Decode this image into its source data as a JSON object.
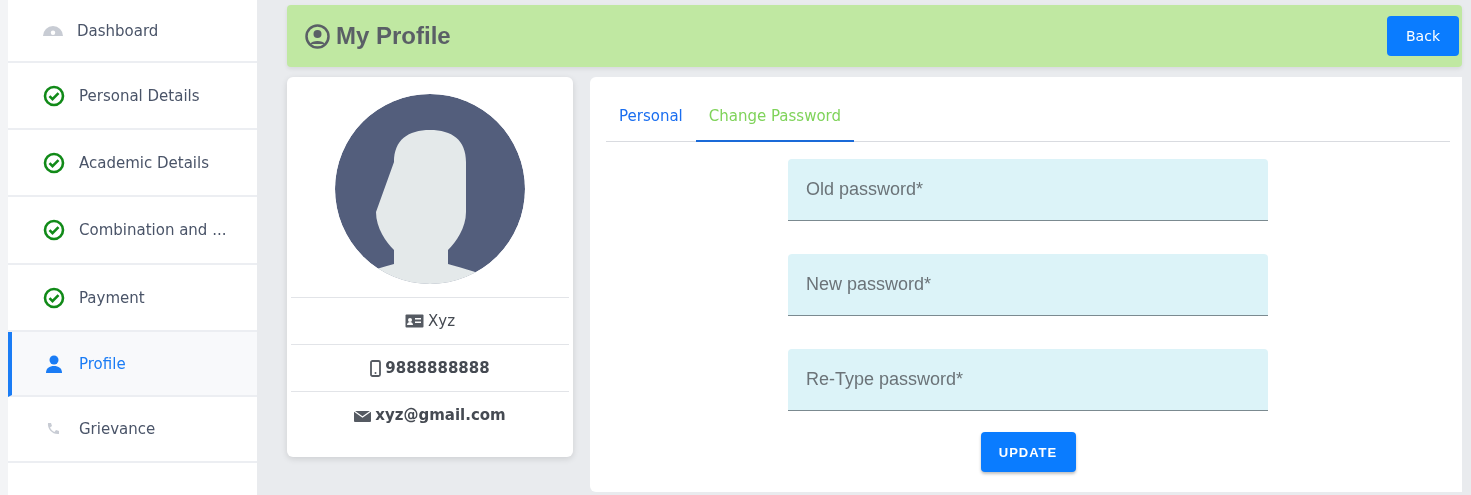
{
  "sidebar": {
    "items": [
      {
        "label": "Dashboard",
        "kind": "dashboard",
        "selected": false
      },
      {
        "label": "Personal Details",
        "kind": "done",
        "selected": false
      },
      {
        "label": "Academic Details",
        "kind": "done",
        "selected": false
      },
      {
        "label": "Combination and ...",
        "kind": "done",
        "selected": false
      },
      {
        "label": "Payment",
        "kind": "done",
        "selected": false
      },
      {
        "label": "Profile",
        "kind": "profile",
        "selected": true
      },
      {
        "label": "Grievance",
        "kind": "phone",
        "selected": false
      }
    ]
  },
  "header": {
    "title": "My Profile",
    "back_button": "Back"
  },
  "profile_card": {
    "avatar": {
      "kind": "silhouette"
    },
    "details": [
      {
        "kind": "id",
        "text": "Xyz"
      },
      {
        "kind": "phone",
        "text": "9888888888"
      },
      {
        "kind": "email",
        "text": "xyz@gmail.com"
      }
    ]
  },
  "tabs": [
    {
      "label": "Personal",
      "selected": false
    },
    {
      "label": "Change Password",
      "selected": true
    }
  ],
  "form": {
    "fields": [
      {
        "placeholder": "Old password*"
      },
      {
        "placeholder": "New password*"
      },
      {
        "placeholder": "Re-Type password*"
      }
    ],
    "submit": "UPDATE"
  }
}
